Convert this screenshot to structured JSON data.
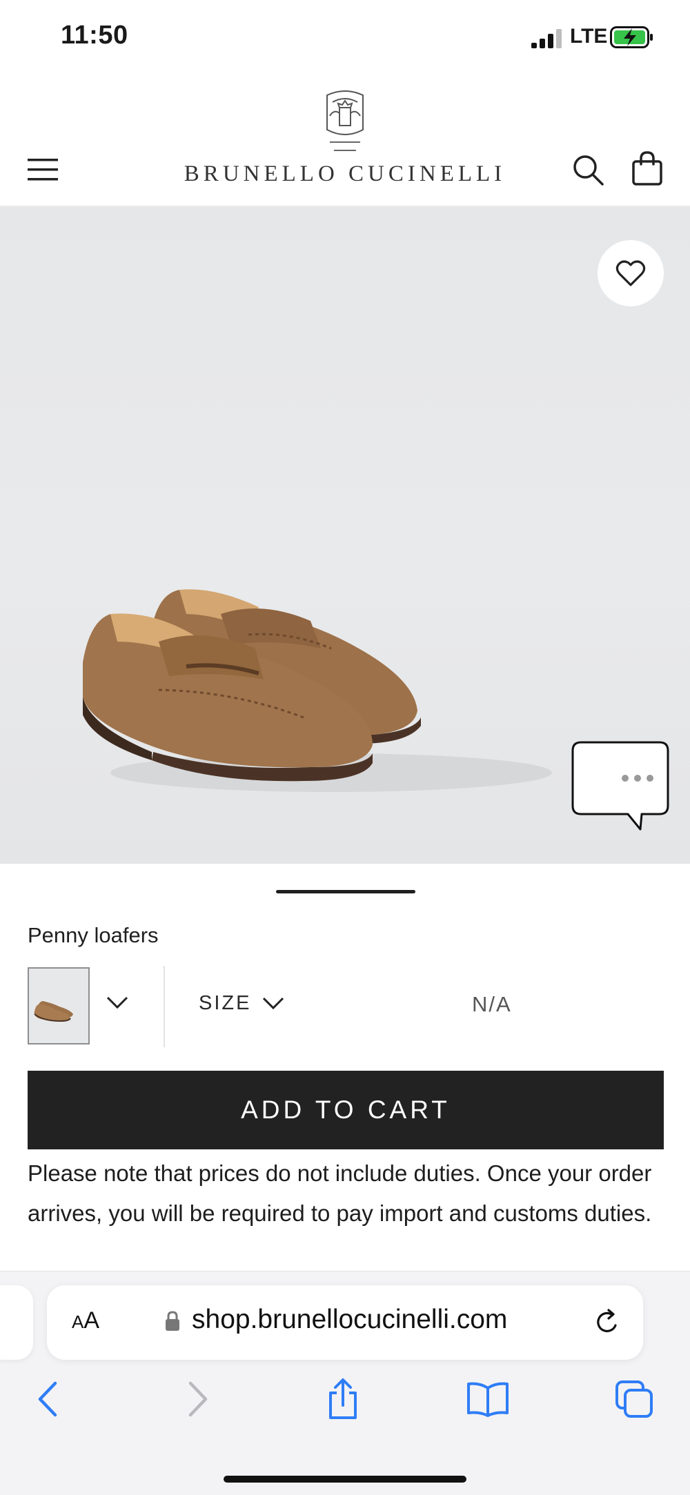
{
  "status_bar": {
    "time": "11:50",
    "network": "LTE",
    "signal_icon": "signal-bars-icon",
    "battery_icon": "battery-charging-icon"
  },
  "header": {
    "brand": "BRUNELLO CUCINELLI",
    "menu_icon": "hamburger-menu-icon",
    "search_icon": "search-icon",
    "bag_icon": "shopping-bag-icon",
    "logo_icon": "brand-crest-logo"
  },
  "product_image": {
    "wishlist_icon": "heart-icon",
    "chat_icon": "chat-bubble-icon"
  },
  "product": {
    "name": "Penny loafers",
    "size_label": "SIZE",
    "price": "N/A",
    "add_to_cart_label": "ADD TO CART",
    "duties_note": "Please note that prices do not include duties. Once your order arrives, you will be required to pay import and customs duties."
  },
  "browser": {
    "text_size_big": "A",
    "text_size_small": "A",
    "url": "shop.brunellocucinelli.com",
    "lock_icon": "lock-icon",
    "reload_icon": "reload-icon",
    "toolbar": [
      "back-icon",
      "forward-icon",
      "share-icon",
      "bookmarks-icon",
      "tabs-icon"
    ]
  },
  "colors": {
    "accent_blue": "#2f7df6",
    "button_dark": "#222222",
    "suede_brown": "#a0744c",
    "sole_dark": "#4a3326",
    "battery_green": "#37c24a"
  }
}
